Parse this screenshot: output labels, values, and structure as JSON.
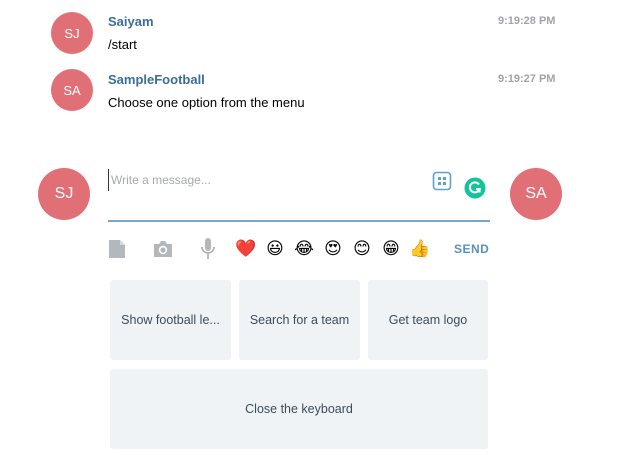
{
  "messages": [
    {
      "initials": "SJ",
      "sender": "Saiyam",
      "text": "/start",
      "time": "9:19:28 PM"
    },
    {
      "initials": "SA",
      "sender": "SampleFootball",
      "text": "Choose one option from the menu",
      "time": "9:19:27 PM"
    }
  ],
  "composer": {
    "left_avatar": "SJ",
    "right_avatar": "SA",
    "placeholder": "Write a message...",
    "send_label": "SEND"
  },
  "emojis": [
    "❤️",
    "😃",
    "😂",
    "😍",
    "😊",
    "😁",
    "👍"
  ],
  "keyboard": {
    "buttons": [
      "Show football le...",
      "Search for a team",
      "Get team logo"
    ],
    "close_label": "Close the keyboard"
  },
  "colors": {
    "avatar": "#e17076",
    "sender": "#3a6d99",
    "send": "#5a8fbf",
    "keyboard_button": "#eff3f6",
    "input_underline": "#7aa6c9"
  }
}
